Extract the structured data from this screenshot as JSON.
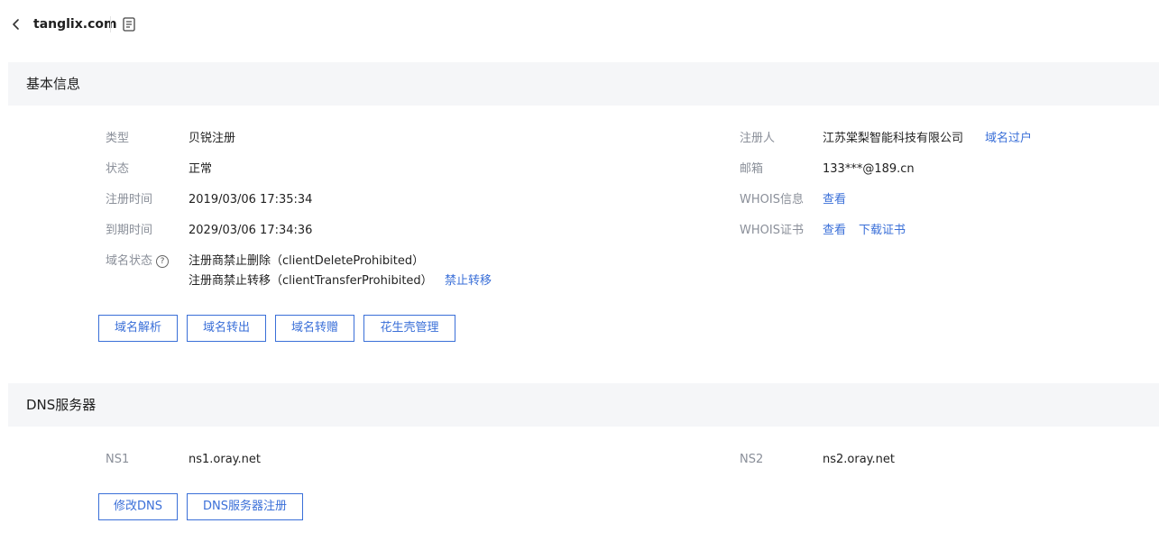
{
  "header": {
    "domain": "tanglix.com"
  },
  "basic_info": {
    "section_title": "基本信息",
    "left_fields": [
      {
        "label": "类型",
        "value": "贝锐注册"
      },
      {
        "label": "状态",
        "value": "正常"
      },
      {
        "label": "注册时间",
        "value": "2019/03/06 17:35:34"
      },
      {
        "label": "到期时间",
        "value": "2029/03/06 17:34:36"
      }
    ],
    "domain_status": {
      "label": "域名状态",
      "help_glyph": "?",
      "lines": [
        "注册商禁止删除（clientDeleteProhibited）",
        "注册商禁止转移（clientTransferProhibited）"
      ],
      "action_link": "禁止转移"
    },
    "right_fields": {
      "registrant": {
        "label": "注册人",
        "value": "江苏棠梨智能科技有限公司",
        "link": "域名过户"
      },
      "email": {
        "label": "邮箱",
        "value": "133***@189.cn"
      },
      "whois_info": {
        "label": "WHOIS信息",
        "link": "查看"
      },
      "whois_cert": {
        "label": "WHOIS证书",
        "link_view": "查看",
        "link_download": "下载证书"
      }
    },
    "buttons": [
      "域名解析",
      "域名转出",
      "域名转赠",
      "花生壳管理"
    ]
  },
  "dns": {
    "section_title": "DNS服务器",
    "ns1": {
      "label": "NS1",
      "value": "ns1.oray.net"
    },
    "ns2": {
      "label": "NS2",
      "value": "ns2.oray.net"
    },
    "buttons": [
      "修改DNS",
      "DNS服务器注册"
    ]
  },
  "colors": {
    "accent": "#3a6fd8",
    "label": "#8a8f99",
    "section_bg": "#f5f6f8"
  }
}
